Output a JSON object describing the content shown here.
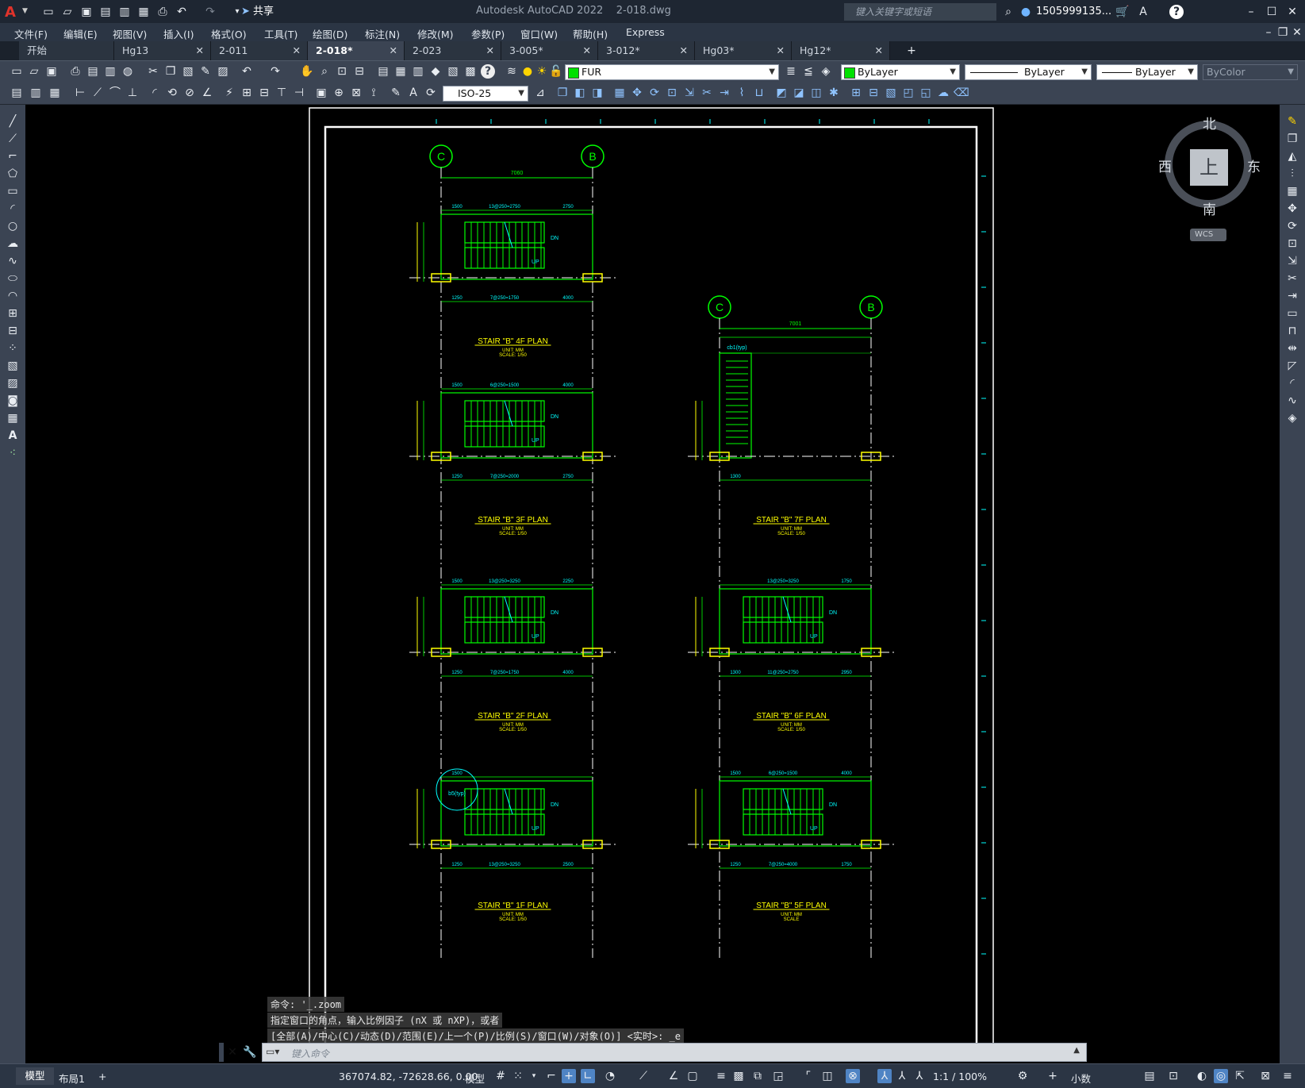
{
  "app": {
    "title": "Autodesk AutoCAD 2022",
    "filename": "2-018.dwg",
    "share_label": "共享",
    "search_placeholder": "键入关键字或短语",
    "user": "1505999135..."
  },
  "menus": [
    "文件(F)",
    "编辑(E)",
    "视图(V)",
    "插入(I)",
    "格式(O)",
    "工具(T)",
    "绘图(D)",
    "标注(N)",
    "修改(M)",
    "参数(P)",
    "窗口(W)",
    "帮助(H)",
    "Express"
  ],
  "tabs": [
    "开始",
    "Hg13",
    "2-011",
    "2-018*",
    "2-023",
    "3-005*",
    "3-012*",
    "Hg03*",
    "Hg12*"
  ],
  "active_tab": "2-018*",
  "toolbar": {
    "layer_name": "FUR",
    "color_label": "ByLayer",
    "linetype_label": "ByLayer",
    "lineweight_label": "ByLayer",
    "plotstyle_label": "ByColor",
    "dimstyle": "ISO-25"
  },
  "viewcube": {
    "north": "北",
    "south": "南",
    "east": "东",
    "west": "西",
    "face": "上",
    "wcs": "WCS"
  },
  "drawing": {
    "axis_left": "C",
    "axis_right": "B",
    "top_dims": [
      "7060",
      "7001"
    ],
    "plans": [
      {
        "title": "STAIR \"B\"  4F  PLAN",
        "unit": "UNIT: MM",
        "scale": "SCALE: 1/50",
        "dims_top": [
          "1500",
          "13@250=2750",
          "2750"
        ],
        "dims_bottom": [
          "1250",
          "7@250=1750",
          "4000"
        ]
      },
      {
        "title": "STAIR \"B\"  3F  PLAN",
        "unit": "UNIT: MM",
        "scale": "SCALE: 1/50",
        "dims_top": [
          "1500",
          "6@250=1500",
          "4000"
        ],
        "dims_bottom": [
          "1250",
          "7@250=2000",
          "2750"
        ]
      },
      {
        "title": "STAIR \"B\"  2F  PLAN",
        "unit": "UNIT: MM",
        "scale": "SCALE: 1/50",
        "dims_top": [
          "1500",
          "13@250=3250",
          "2250"
        ],
        "dims_bottom": [
          "1250",
          "7@250=1750",
          "4000"
        ]
      },
      {
        "title": "STAIR \"B\"  1F  PLAN",
        "unit": "UNIT: MM",
        "scale": "SCALE: 1/50",
        "dims_top": [
          "1500",
          "",
          ""
        ],
        "dims_bottom": [
          "1250",
          "13@250=3250",
          "2500"
        ]
      },
      {
        "title": "STAIR \"B\"  7F  PLAN",
        "unit": "UNIT: MM",
        "scale": "SCALE: 1/50",
        "dims_top": [
          "",
          "",
          ""
        ],
        "dims_bottom": [
          "1300",
          "",
          ""
        ]
      },
      {
        "title": "STAIR \"B\"  6F  PLAN",
        "unit": "UNIT: MM",
        "scale": "SCALE: 1/50",
        "dims_top": [
          "",
          "13@250=3250",
          "1750"
        ],
        "dims_bottom": [
          "1300",
          "11@250=2750",
          "2950"
        ]
      },
      {
        "title": "STAIR \"B\"  5F  PLAN",
        "unit": "UNIT: MM",
        "scale": "SCALE",
        "dims_top": [
          "1500",
          "6@250=1500",
          "4000"
        ],
        "dims_bottom": [
          "1250",
          "7@250=4000",
          "1750"
        ]
      }
    ],
    "labels": {
      "dn": "DN",
      "up": "UP",
      "typ": "cb1(typ)",
      "b5": "b5(typ)"
    }
  },
  "command": {
    "history": [
      "命令: '_.zoom",
      "指定窗口的角点，输入比例因子 (nX 或 nXP)，或者",
      "[全部(A)/中心(C)/动态(D)/范围(E)/上一个(P)/比例(S)/窗口(W)/对象(O)] <实时>: _e"
    ],
    "placeholder": "键入命令"
  },
  "status": {
    "model_tab": "模型",
    "layout_tab": "布局1",
    "coords": "367074.82, -72628.66, 0.00",
    "space": "模型",
    "scale": "1:1 / 100%",
    "units": "小数"
  },
  "colors": {
    "green": "#00ff00",
    "yellow": "#ffff00",
    "cyan": "#00ffff",
    "white": "#ffffff",
    "accent": "#4f84c4"
  }
}
